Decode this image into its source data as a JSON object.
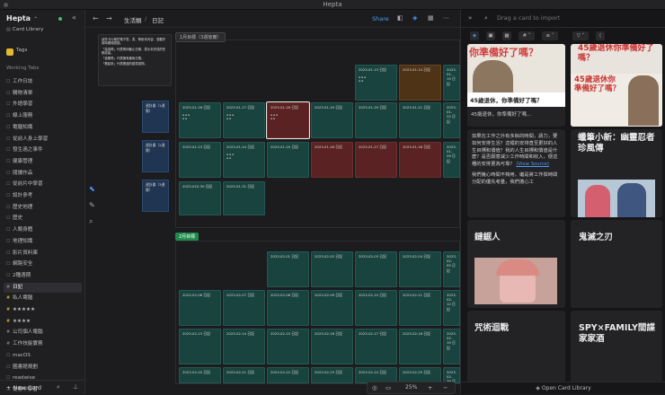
{
  "app": {
    "title": "Hepta",
    "workspace": "Hepta"
  },
  "sidebar": {
    "top_items": [
      {
        "label": "Card Library",
        "icon": "library-icon"
      },
      {
        "label": "Tags",
        "icon": "tag-icon"
      }
    ],
    "section": "Working Tabs",
    "items": [
      "工作日誌",
      "購物清單",
      "外語學習",
      "線上服務",
      "電腦知識",
      "從前人身上學習",
      "發生過之事件",
      "健康管理",
      "閱讀作品",
      "從前片中學習",
      "設計參考",
      "歷史地理",
      "歷史",
      "人類身體",
      "地理知識",
      "影片資料庫",
      "網路安全",
      "2種週期",
      "日記",
      "私人電腦",
      "★★★★★",
      "★★★★",
      "公司個人電腦",
      "工作技能實務",
      "macOS",
      "圖書館規劃",
      "readwise",
      "從書中學習"
    ],
    "active": "日記",
    "new_card": "New Card"
  },
  "topbar": {
    "breadcrumb_parent": "生活類",
    "breadcrumb_current": "日記",
    "share": "Share"
  },
  "note": {
    "lines": [
      "這些卡片屬於電子書、書、等紙本內容，須要於某時間段閱讀。",
      "「高挑再」代表等待截止日期，表示未完成的任務或者。",
      "「逾期再」代表擁有最後日期。",
      "「看起來」代表看過的讀書讀物。"
    ]
  },
  "jan": {
    "label": "1月目標（3週後實）",
    "weekly": [
      "週計畫（1週實）",
      "週計畫（2週實）",
      "週計畫（3週實）",
      "週計畫（4週實）"
    ],
    "row1": [
      "2023-01-13 日記",
      "2023-01-14 日記",
      "2023-01-15 日記"
    ],
    "row2": [
      "2023-01-16 日記",
      "2023-01-17 日記",
      "2023-01-18 日記",
      "2023-01-19 日記",
      "2023-01-20 日記",
      "2023-01-21 日記",
      "2023-01-22 日記"
    ],
    "row3": [
      "2023-01-23 日記",
      "2023-01-24 日記",
      "2023-01-25 日記",
      "2023-01-26 日記",
      "2023-01-27 日記",
      "2023-01-28 日記",
      "2023-01-29 日記"
    ],
    "row4": [
      "2023-010-30 日記",
      "2023-01-31 日記"
    ]
  },
  "feb": {
    "label": "2月目標",
    "row1": [
      "2023-02-01 日記",
      "2023-02-02 日記",
      "2023-02-03 日記",
      "2023-02-04 日記",
      "2023-02-05 日記"
    ],
    "row2": [
      "2023-02-06 日記",
      "2023-02-07 日記",
      "2023-02-08 日記",
      "2023-02-09 日記",
      "2023-02-10 日記",
      "2023-02-11 日記",
      "2023-02-12 日記"
    ],
    "row3": [
      "2023-02-13 日記",
      "2023-02-14 日記",
      "2023-02-15 日記",
      "2023-02-16 日記",
      "2023-02-17 日記",
      "2023-02-18 日記",
      "2023-02-19 日記"
    ],
    "row4": [
      "2023-02-20 日記",
      "2023-02-21 日記",
      "2023-02-22 日記",
      "2023-02-23 日記",
      "2023-02-24 日記",
      "2023-02-25 日記",
      "2023-02-26 日記"
    ]
  },
  "zoom": {
    "value": "25%"
  },
  "right": {
    "search_placeholder": "Drag a card to import",
    "cards": {
      "c1_title": "你準備好了嗎？",
      "c1_thumb": "45歲退休，你準備好了嗎？",
      "c1_caption": "45歲退休，你準備好了嗎...",
      "c2_title": "45歲退休你準備好了嗎？",
      "c2_thumb": "45歲退休你準備好了嗎？",
      "c3_text": "如果在工作之外有多餘的時間，請力，要如何安排生活？這裡的安排直至更好的人生目標和價值？我的人生目標和價值是什麼？是否願意減少工作時間和收入，便這種的安排更為可靠？",
      "c3_link": "(View Source)",
      "c3_more": "我們擁心時間不夠用，繼是將工作與時間分配的優先考量，我們擔心工",
      "c4_title": "蠟筆小新：幽靈忍者珍風傳",
      "c5_title": "鏈鋸人",
      "c6_title": "鬼滅之刃",
      "c7_title": "咒術迴戰",
      "c8_title": "SPY×FAMILY間諜家家酒"
    },
    "open_library": "Open Card Library"
  }
}
